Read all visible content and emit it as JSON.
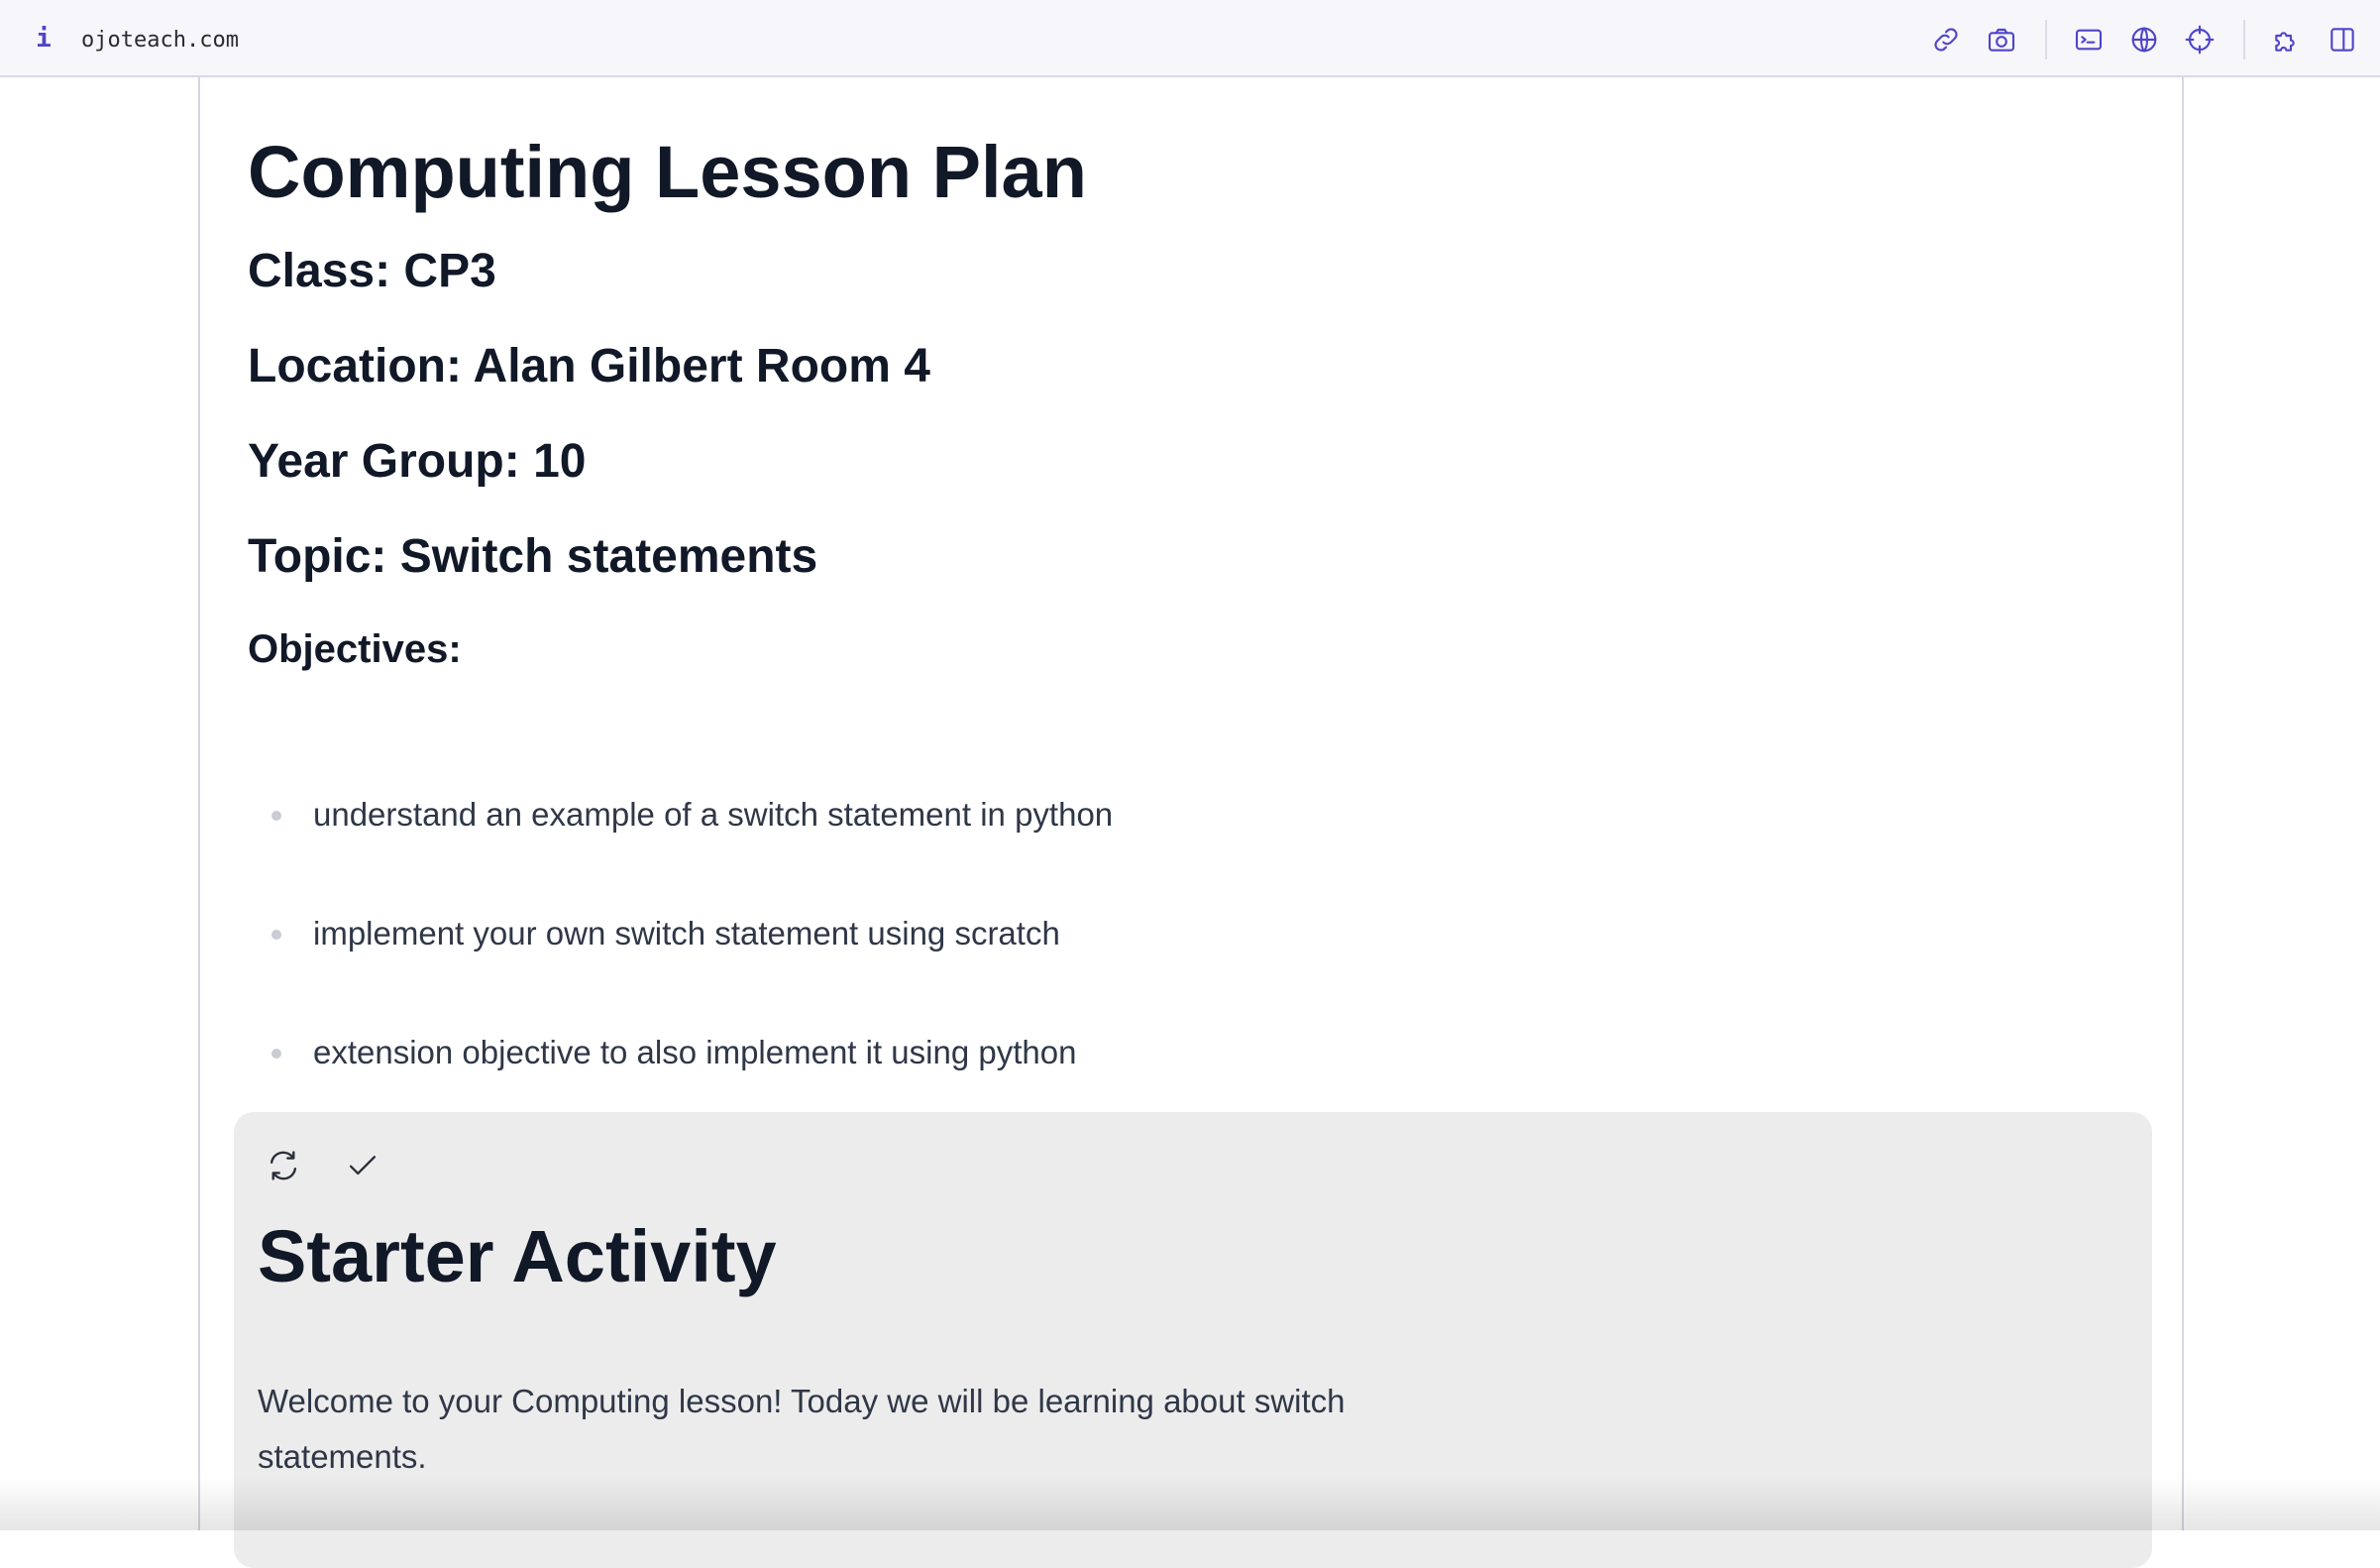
{
  "browser": {
    "url": "ojoteach.com",
    "info_icon": "i",
    "toolbar_icons": [
      "link-icon",
      "camera-icon",
      "terminal-icon",
      "globe-icon",
      "crosshair-icon",
      "puzzle-icon",
      "sidebar-icon"
    ]
  },
  "lesson": {
    "title": "Computing Lesson Plan",
    "class_line": "Class: CP3",
    "location_line": "Location: Alan Gilbert Room 4",
    "year_line": "Year Group: 10",
    "topic_line": "Topic: Switch statements",
    "objectives_heading": "Objectives:",
    "objectives": [
      "understand an example of a switch statement in python",
      "implement your own switch statement using scratch",
      "extension objective to also implement it using python"
    ]
  },
  "starter": {
    "icons": [
      "refresh-icon",
      "check-icon"
    ],
    "title": "Starter Activity",
    "body": "Welcome to your Computing lesson! Today we will be learning about switch statements."
  },
  "colors": {
    "accent": "#4f46c8",
    "text": "#111827",
    "body_text": "#2f3747",
    "card_bg": "#ececec"
  }
}
